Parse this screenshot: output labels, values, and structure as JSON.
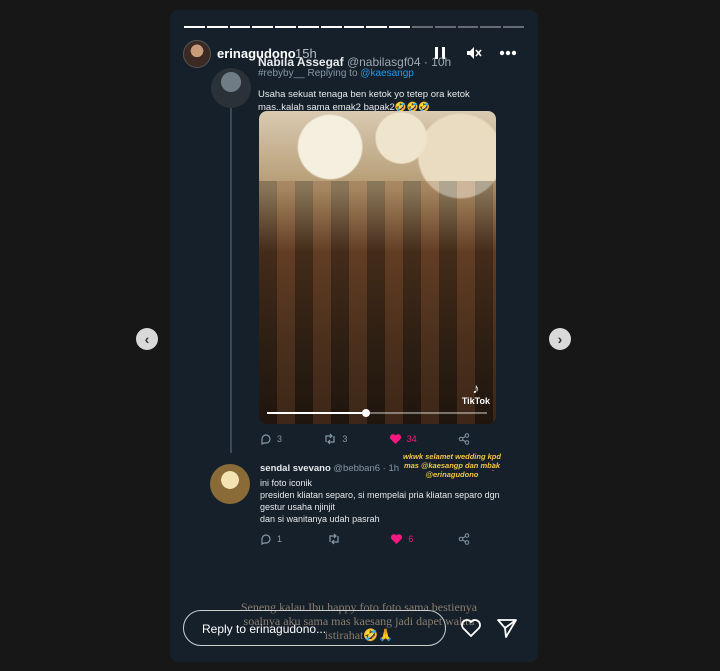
{
  "story": {
    "progress_total": 15,
    "progress_done": 10,
    "username": "erinagudono",
    "time": "15h",
    "icons": [
      "pause-icon",
      "mute-icon",
      "more-icon"
    ]
  },
  "tweet1": {
    "name": "Nabila Assegaf",
    "handle": "@nabilasgf04 · 10h",
    "replying_prefix": "Replying to",
    "replying_to": "@kaesangp",
    "text": "Usaha sekuat tenaga ben ketok yo tetep ora ketok mas..kalah sama emak2 bapak2🤣🤣🤣",
    "overlay_label": "#rebyby__",
    "media_label": "TikTok",
    "video_progress": 0.45,
    "actions": {
      "replies": "3",
      "retweets": "3",
      "likes": "34"
    }
  },
  "tweet2": {
    "name": "sendal svevano",
    "handle": "@bebban6 · 1h",
    "text": "ini foto iconik\npresiden kliatan separo, si mempelai pria kliatan separo dgn gestur usaha njinjit\ndan si wanitanya udah pasrah",
    "actions": {
      "replies": "1",
      "retweets": "",
      "likes": "6"
    }
  },
  "yellow_caption": "wkwk selamet wedding kpd mas @kaesangp dan mbak @erinagudono",
  "story_caption": "Seneng kalau Ibu happy foto foto sama bestienya soalnya aku sama mas kaesang jadi dapet waktu istirahat🤣🙏",
  "reply": {
    "placeholder": "Reply to erinagudono..."
  },
  "colors": {
    "like": "#f91880",
    "mention": "#1d9bf0",
    "background": "#15202b",
    "yellow": "#f5c542"
  }
}
